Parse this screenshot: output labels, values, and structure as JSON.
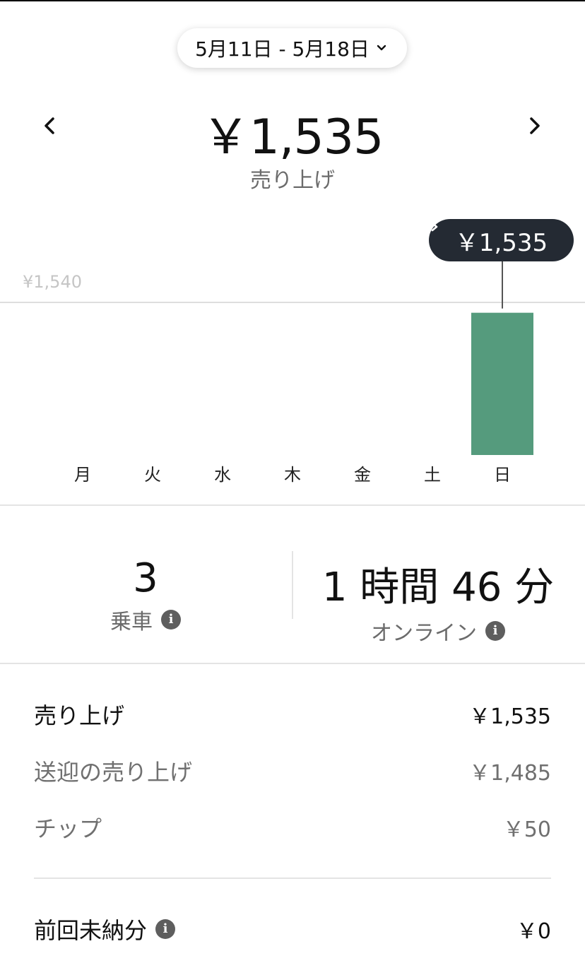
{
  "header": {
    "date_range": "5月11日 - 5月18日",
    "total": "￥1,535",
    "total_label": "売り上げ"
  },
  "chart_data": {
    "type": "bar",
    "categories": [
      "月",
      "火",
      "水",
      "木",
      "金",
      "土",
      "日"
    ],
    "values": [
      0,
      0,
      0,
      0,
      0,
      0,
      1535
    ],
    "ylim": [
      0,
      1540
    ],
    "y_max_label": "¥1,540",
    "selected_tooltip": "￥1,535",
    "selected_index": 6,
    "bar_color": "#559b7d",
    "tooltip_color": "#242a33"
  },
  "stats": {
    "trips_value": "3",
    "trips_label": "乗車",
    "online_value": "1 時間 46 分",
    "online_label": "オンライン"
  },
  "breakdown": {
    "sales_label": "売り上げ",
    "sales_value": "￥1,535",
    "fare_label": "送迎の売り上げ",
    "fare_value": "￥1,485",
    "tip_label": "チップ",
    "tip_value": "￥50",
    "previous_label": "前回未納分",
    "previous_value": "￥0"
  },
  "icons": {
    "info": "i"
  }
}
